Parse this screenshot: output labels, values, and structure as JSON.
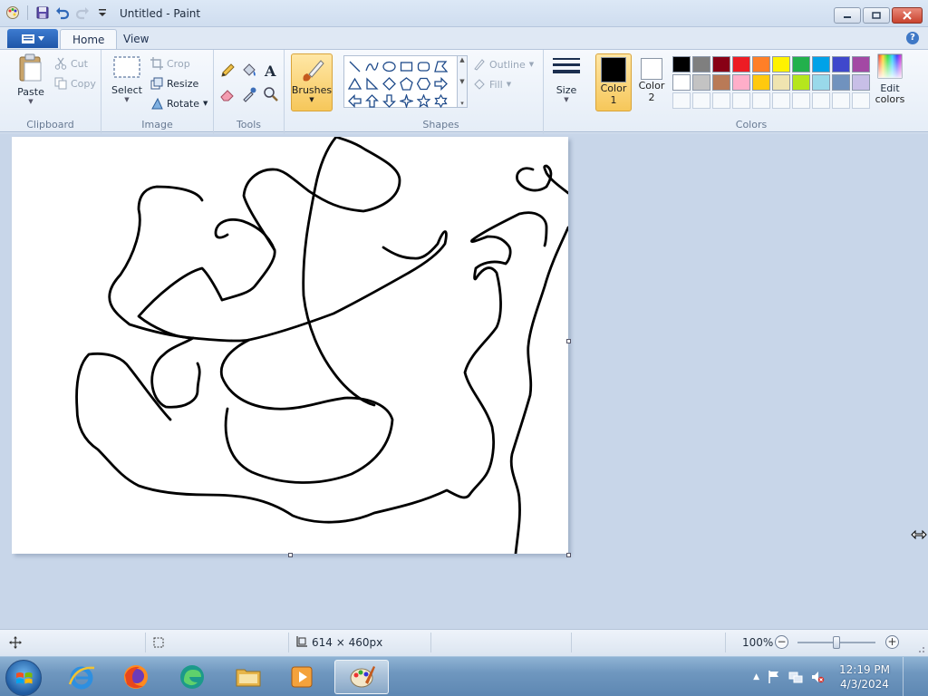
{
  "window": {
    "title": "Untitled - Paint"
  },
  "tabs": {
    "home": "Home",
    "view": "View"
  },
  "clipboard": {
    "paste": "Paste",
    "cut": "Cut",
    "copy": "Copy",
    "label": "Clipboard"
  },
  "image": {
    "select": "Select",
    "crop": "Crop",
    "resize": "Resize",
    "rotate": "Rotate",
    "label": "Image"
  },
  "tools": {
    "label": "Tools"
  },
  "brushes": {
    "label": "Brushes"
  },
  "shapes": {
    "outline": "Outline",
    "fill": "Fill",
    "label": "Shapes"
  },
  "size": {
    "label": "Size"
  },
  "colors": {
    "color1_label": "Color",
    "color1_num": "1",
    "color2_label": "Color",
    "color2_num": "2",
    "color1_value": "#000000",
    "color2_value": "#ffffff",
    "edit_label": "Edit",
    "edit_label2": "colors",
    "label": "Colors",
    "palette": [
      "#000000",
      "#7f7f7f",
      "#880015",
      "#ed1c24",
      "#ff7f27",
      "#fff200",
      "#22b14c",
      "#00a2e8",
      "#3f48cc",
      "#a349a4",
      "#ffffff",
      "#c3c3c3",
      "#b97a57",
      "#ffaec9",
      "#ffc90e",
      "#efe4b0",
      "#b5e61d",
      "#99d9ea",
      "#7092be",
      "#c8bfe7"
    ]
  },
  "statusbar": {
    "dimensions": "614 × 460px",
    "zoom": "100%",
    "zoom_level": 1.0
  },
  "taskbar": {
    "time": "12:19 PM",
    "date": "4/3/2024"
  }
}
